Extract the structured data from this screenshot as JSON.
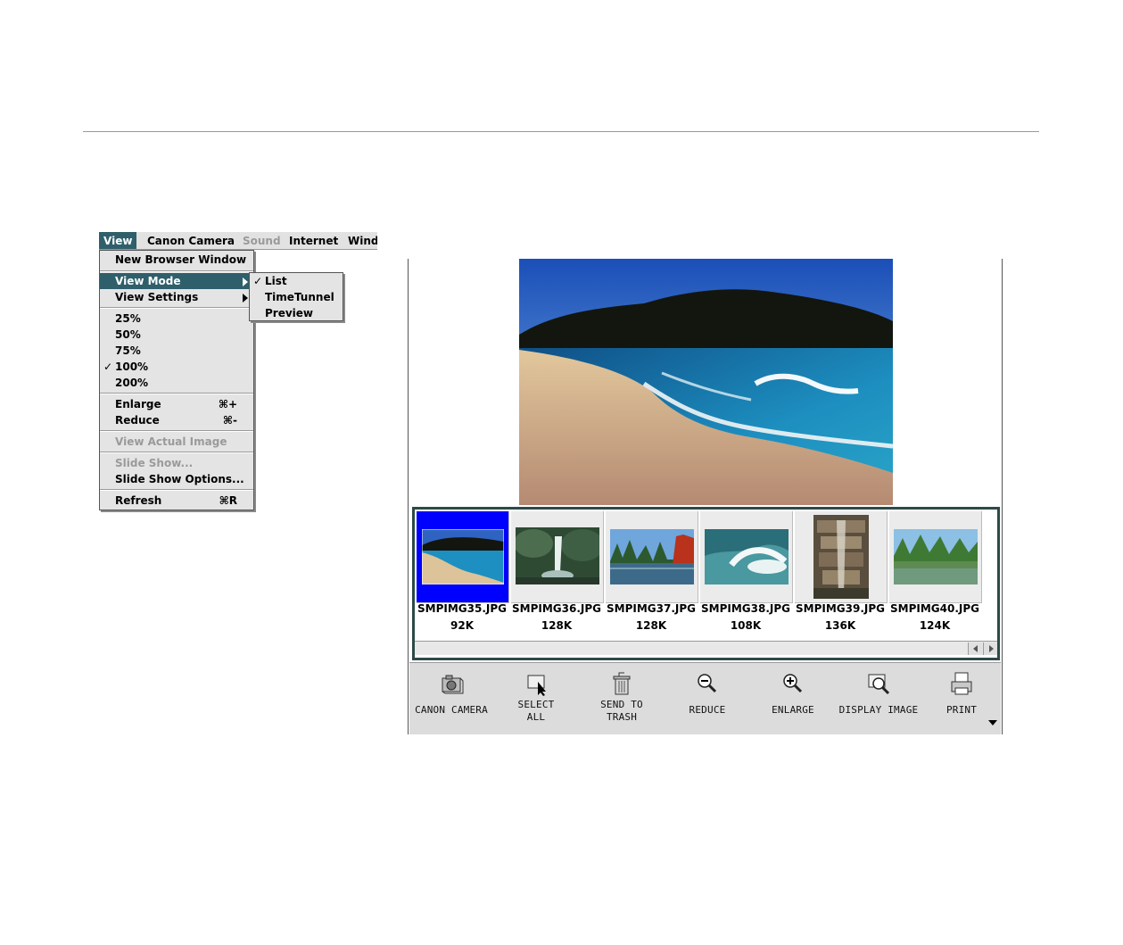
{
  "menubar": {
    "items": [
      {
        "label": "View"
      },
      {
        "label": "Canon Camera"
      },
      {
        "label": "Sound"
      },
      {
        "label": "Internet"
      },
      {
        "label": "Windo"
      }
    ]
  },
  "view_menu": {
    "new_browser_window": "New Browser Window",
    "view_mode": "View Mode",
    "view_settings": "View Settings",
    "zoom_25": "25%",
    "zoom_50": "50%",
    "zoom_75": "75%",
    "zoom_100": "100%",
    "zoom_200": "200%",
    "checkmark": "✓",
    "enlarge": "Enlarge",
    "enlarge_shortcut": "⌘+",
    "reduce": "Reduce",
    "reduce_shortcut": "⌘-",
    "view_actual_image": "View Actual Image",
    "slide_show": "Slide Show...",
    "slide_show_options": "Slide Show Options...",
    "refresh": "Refresh",
    "refresh_shortcut": "⌘R"
  },
  "view_mode_submenu": {
    "list": "List",
    "timetunnel": "TimeTunnel",
    "preview": "Preview",
    "checkmark": "✓"
  },
  "thumbnails": [
    {
      "name": "SMPIMG35.JPG",
      "size": "92K",
      "selected": true
    },
    {
      "name": "SMPIMG36.JPG",
      "size": "128K"
    },
    {
      "name": "SMPIMG37.JPG",
      "size": "128K"
    },
    {
      "name": "SMPIMG38.JPG",
      "size": "108K"
    },
    {
      "name": "SMPIMG39.JPG",
      "size": "136K"
    },
    {
      "name": "SMPIMG40.JPG",
      "size": "124K"
    }
  ],
  "toolbar": {
    "canon_camera": "CANON CAMERA",
    "select_all": "SELECT\nALL",
    "send_to_trash": "SEND TO\nTRASH",
    "reduce": "REDUCE",
    "enlarge": "ENLARGE",
    "display_image": "DISPLAY IMAGE",
    "print": "PRINT"
  },
  "colors": {
    "menu_highlight": "#2f5f6b",
    "selection": "#0000ff",
    "strip_border": "#2d4a48",
    "rule": "#b48c96"
  }
}
